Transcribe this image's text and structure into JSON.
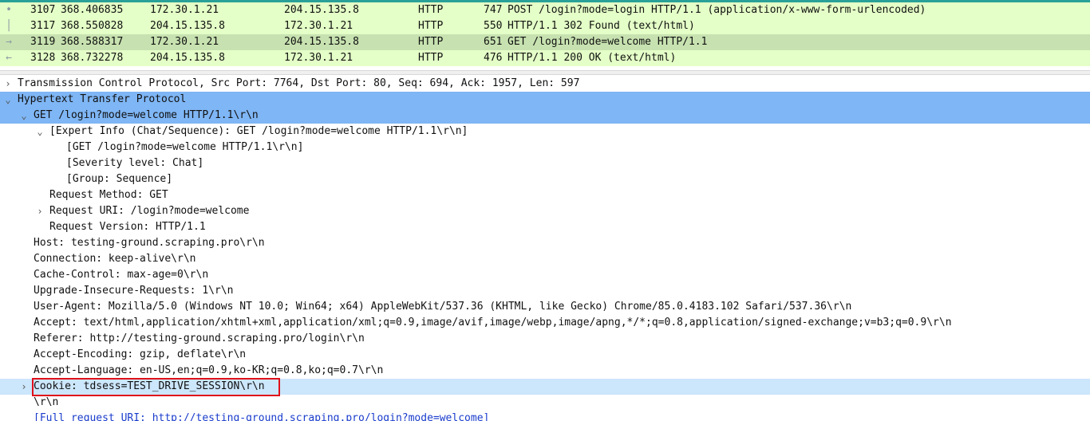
{
  "packets": [
    {
      "no": "3107",
      "time": "368.406835",
      "src": "172.30.1.21",
      "dst": "204.15.135.8",
      "proto": "HTTP",
      "len": "747",
      "info": "POST /login?mode=login HTTP/1.1  (application/x-www-form-urlencoded)",
      "gutter": "•"
    },
    {
      "no": "3117",
      "time": "368.550828",
      "src": "204.15.135.8",
      "dst": "172.30.1.21",
      "proto": "HTTP",
      "len": "550",
      "info": "HTTP/1.1 302 Found  (text/html)",
      "gutter": "│"
    },
    {
      "no": "3119",
      "time": "368.588317",
      "src": "172.30.1.21",
      "dst": "204.15.135.8",
      "proto": "HTTP",
      "len": "651",
      "info": "GET /login?mode=welcome HTTP/1.1",
      "gutter": "→"
    },
    {
      "no": "3128",
      "time": "368.732278",
      "src": "204.15.135.8",
      "dst": "172.30.1.21",
      "proto": "HTTP",
      "len": "476",
      "info": "HTTP/1.1 200 OK  (text/html)",
      "gutter": "←"
    }
  ],
  "tree": {
    "tcp": "Transmission Control Protocol, Src Port: 7764, Dst Port: 80, Seq: 694, Ack: 1957, Len: 597",
    "http": "Hypertext Transfer Protocol",
    "request_line": "GET /login?mode=welcome HTTP/1.1\\r\\n",
    "expert_info": "[Expert Info (Chat/Sequence): GET /login?mode=welcome HTTP/1.1\\r\\n]",
    "expert_msg": "[GET /login?mode=welcome HTTP/1.1\\r\\n]",
    "severity": "[Severity level: Chat]",
    "group": "[Group: Sequence]",
    "method": "Request Method: GET",
    "uri": "Request URI: /login?mode=welcome",
    "version": "Request Version: HTTP/1.1",
    "host": "Host: testing-ground.scraping.pro\\r\\n",
    "connection": "Connection: keep-alive\\r\\n",
    "cache_control": "Cache-Control: max-age=0\\r\\n",
    "upgrade": "Upgrade-Insecure-Requests: 1\\r\\n",
    "user_agent": "User-Agent: Mozilla/5.0 (Windows NT 10.0; Win64; x64) AppleWebKit/537.36 (KHTML, like Gecko) Chrome/85.0.4183.102 Safari/537.36\\r\\n",
    "accept": "Accept: text/html,application/xhtml+xml,application/xml;q=0.9,image/avif,image/webp,image/apng,*/*;q=0.8,application/signed-exchange;v=b3;q=0.9\\r\\n",
    "referer": "Referer: http://testing-ground.scraping.pro/login\\r\\n",
    "accept_encoding": "Accept-Encoding: gzip, deflate\\r\\n",
    "accept_language": "Accept-Language: en-US,en;q=0.9,ko-KR;q=0.8,ko;q=0.7\\r\\n",
    "cookie": "Cookie: tdsess=TEST_DRIVE_SESSION\\r\\n",
    "crlf": "\\r\\n",
    "full_uri": "[Full request URI: http://testing-ground.scraping.pro/login?mode=welcome]"
  },
  "icons": {
    "collapsed": "›",
    "expanded": "⌄"
  },
  "colors": {
    "packet_row": "#e4ffc7",
    "packet_selected": "#c7e2b0",
    "tree_selected": "#7fb6f5",
    "tree_hover": "#cce6fb",
    "annotation_box": "#e0101a"
  }
}
